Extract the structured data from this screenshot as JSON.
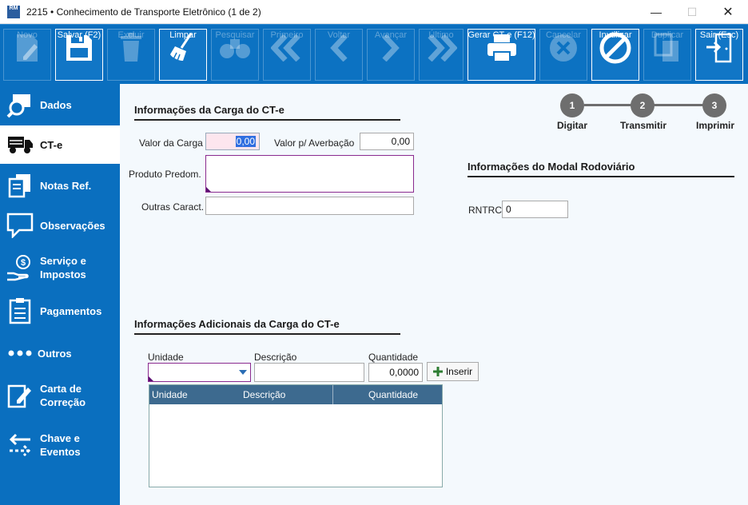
{
  "window": {
    "app_icon_text": "RM",
    "title": "2215 • Conhecimento de Transporte Eletrônico (1 de 2)",
    "min_label": "—",
    "max_label": "☐",
    "close_label": "✕"
  },
  "toolbar": {
    "novo": "Novo",
    "salvar": "Salvar (F2)",
    "excluir": "Excluir",
    "limpar": "Limpar",
    "pesquisar": "Pesquisar",
    "primeiro": "Primeiro",
    "voltar": "Voltar",
    "avancar": "Avançar",
    "ultimo": "Último",
    "gerar": "Gerar CT-e (F12)",
    "cancelar": "Cancelar",
    "inutilizar": "Inutilizar",
    "duplicar": "Duplicar",
    "sair": "Sair (Esc)"
  },
  "sidebar": {
    "dados": "Dados",
    "cte": "CT-e",
    "notas": "Notas Ref.",
    "observacoes": "Observações",
    "servico_1": "Serviço e",
    "servico_2": "Impostos",
    "pagamentos": "Pagamentos",
    "outros": "Outros",
    "carta_1": "Carta de",
    "carta_2": "Correção",
    "chave_1": "Chave e",
    "chave_2": "Eventos"
  },
  "carga": {
    "section_title": "Informações da Carga do CT-e",
    "valor_carga_label": "Valor da Carga",
    "valor_carga_value": "0,00",
    "valor_averbacao_label": "Valor p/ Averbação",
    "valor_averbacao_value": "0,00",
    "produto_label": "Produto Predom.",
    "produto_value": "",
    "outras_label": "Outras Caract.",
    "outras_value": ""
  },
  "stepper": {
    "s1": "1",
    "l1": "Digitar",
    "s2": "2",
    "l2": "Transmitir",
    "s3": "3",
    "l3": "Imprimir"
  },
  "modal": {
    "section_title": "Informações do Modal Rodoviário",
    "rntrc_label": "RNTRC",
    "rntrc_value": "0"
  },
  "adicionais": {
    "section_title": "Informações Adicionais da Carga do CT-e",
    "unidade_label": "Unidade",
    "descricao_label": "Descrição",
    "quantidade_label": "Quantidade",
    "quantidade_value": "0,0000",
    "inserir_label": "Inserir",
    "grid_columns": [
      "Unidade",
      "Descrição",
      "Quantidade"
    ]
  }
}
